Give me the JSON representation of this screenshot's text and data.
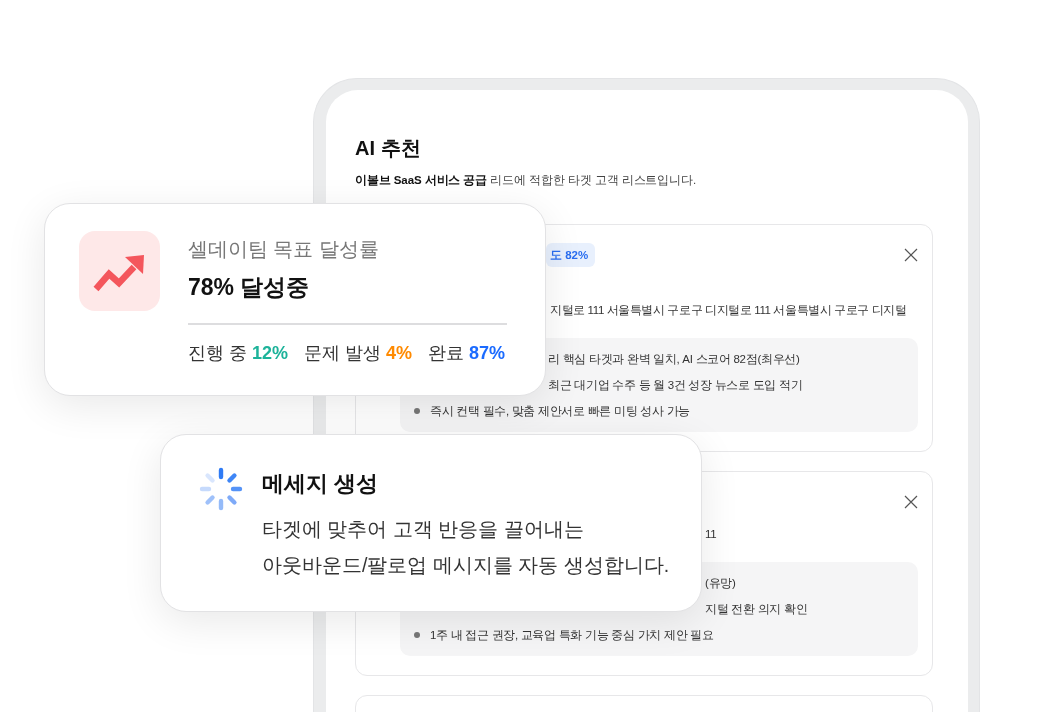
{
  "tablet": {
    "title": "AI 추천",
    "subtitle": "**이볼브 SaaS 서비스 공급** 리드에 적합한 타겟 고객 리스트입니다.",
    "cards": [
      {
        "badge": "도 82%",
        "detail": "지털로 111 서울특별시 구로구 디지털로 111 서울특별시 구로구 디지털",
        "points": [
          {
            "text": "리 핵심 타겟과 완벽 일치, AI 스코어 82점(최우선)",
            "marker": false
          },
          {
            "text": "최근 대기업 수주 등 월 3건 성장 뉴스로 도입 적기",
            "marker": false
          },
          {
            "text": "즉시 컨택 필수, 맞춤 제안서로 빠른 미팅 성사 가능",
            "marker": true
          }
        ]
      },
      {
        "detail": "11",
        "points": [
          {
            "text": "(유망)",
            "marker": false
          },
          {
            "text": "지털 전환 의지 확인",
            "marker": false
          },
          {
            "text": "1주 내 접근 권장, 교육업 특화 기능 중심 가치 제안 필요",
            "marker": true
          }
        ]
      }
    ]
  },
  "goal_card": {
    "title": "셀데이팀 목표 달성률",
    "value": "78% 달성중",
    "stats": [
      {
        "label": "진행 중",
        "value": "12%",
        "color": "#1db39a"
      },
      {
        "label": "문제 발생",
        "value": "4%",
        "color": "#ff8a00"
      },
      {
        "label": "완료",
        "value": "87%",
        "color": "#1b6bff"
      }
    ]
  },
  "message_card": {
    "title": "메세지 생성",
    "lines": [
      "타겟에 맞추어 고객 반응을 끌어내는",
      "아웃바운드/팔로업 메시지를 자동 생성합니다."
    ]
  }
}
